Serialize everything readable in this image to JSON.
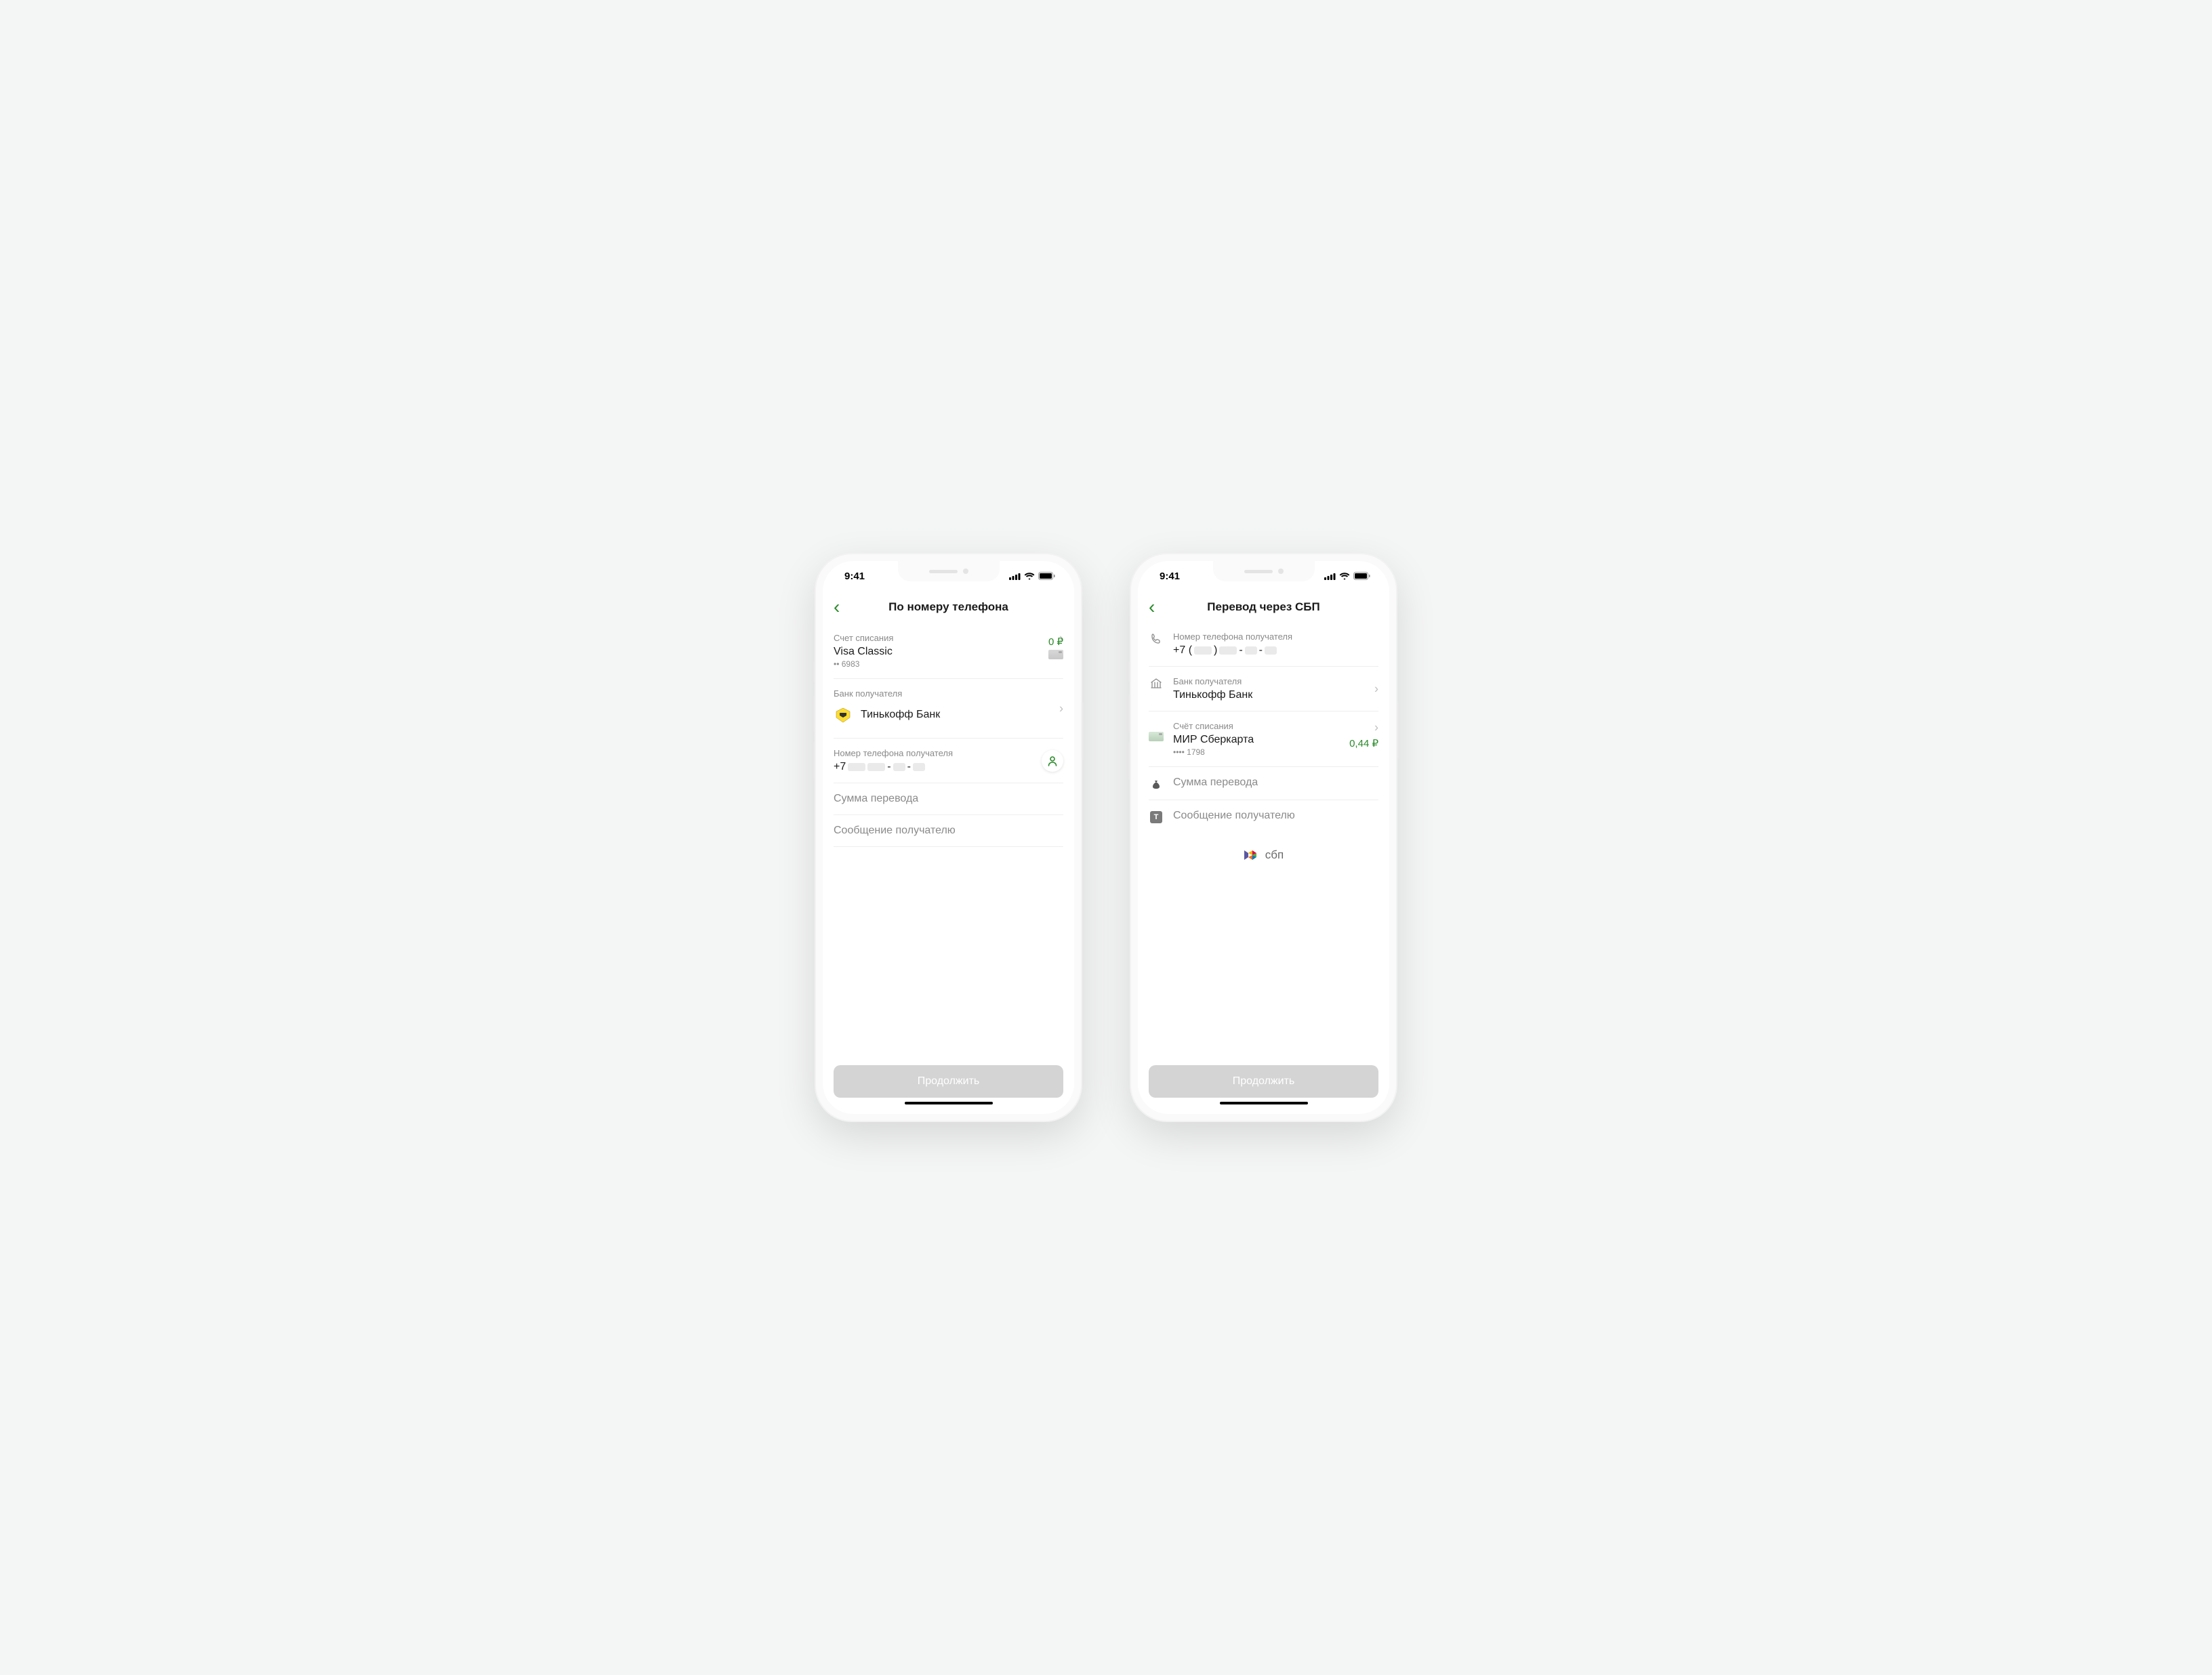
{
  "status": {
    "time": "9:41"
  },
  "left": {
    "title": "По номеру телефона",
    "source": {
      "label": "Счет списания",
      "card_name": "Visa Classic",
      "card_masked": "•• 6983",
      "balance": "0 ₽"
    },
    "bank": {
      "label": "Банк получателя",
      "name": "Тинькофф Банк"
    },
    "phone": {
      "label": "Номер телефона получателя",
      "prefix": "+7"
    },
    "amount": {
      "placeholder": "Сумма перевода"
    },
    "message": {
      "placeholder": "Сообщение получателю"
    },
    "cta": "Продолжить"
  },
  "right": {
    "title": "Перевод через СБП",
    "phone": {
      "label": "Номер телефона получателя",
      "prefix": "+7 ("
    },
    "bank": {
      "label": "Банк получателя",
      "name": "Тинькофф Банк"
    },
    "source": {
      "label": "Счёт списания",
      "card_name": "МИР Сберкарта",
      "card_masked": "•••• 1798",
      "balance": "0,44 ₽"
    },
    "amount": {
      "placeholder": "Сумма перевода"
    },
    "message": {
      "placeholder": "Сообщение получателю"
    },
    "sbp_label": "сбп",
    "cta": "Продолжить"
  }
}
